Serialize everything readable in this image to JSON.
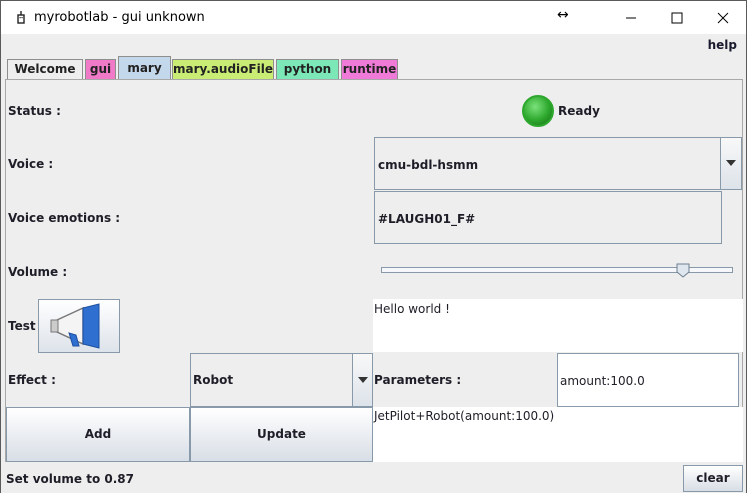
{
  "window": {
    "title": "myrobotlab - gui unknown",
    "resize_glyph": "↔",
    "minimize_glyph": "—",
    "maximize_glyph": "☐",
    "close_glyph": "✕"
  },
  "menu": {
    "help_label": "help"
  },
  "tabs": [
    {
      "label": "Welcome",
      "color": "#eeeeee",
      "selected": false
    },
    {
      "label": "gui",
      "color": "#f07ac8",
      "selected": false
    },
    {
      "label": "mary",
      "color": "#c4d8ec",
      "selected": true
    },
    {
      "label": "mary.audioFile",
      "color": "#c9ec74",
      "selected": false
    },
    {
      "label": "python",
      "color": "#7ce8b8",
      "selected": false
    },
    {
      "label": "runtime",
      "color": "#f07ad8",
      "selected": false
    }
  ],
  "form": {
    "status_label": "Status :",
    "status_value": "Ready",
    "status_color": "#2da82d",
    "voice_label": "Voice :",
    "voice_value": "cmu-bdl-hsmm",
    "emotions_label": "Voice emotions :",
    "emotions_value": "#LAUGH01_F#",
    "volume_label": "Volume :",
    "volume_level": 0.87,
    "test_label": "Test :",
    "test_icon": "megaphone-icon",
    "say_text": "Hello world !",
    "effect_label": "Effect :",
    "effect_value": "Robot",
    "parameters_label": "Parameters :",
    "parameters_value": "amount:100.0",
    "effects_text": "JetPilot+Robot(amount:100.0)",
    "add_label": "Add",
    "update_label": "Update"
  },
  "statusbar": {
    "message": "Set volume to 0.87",
    "clear_label": "clear"
  }
}
